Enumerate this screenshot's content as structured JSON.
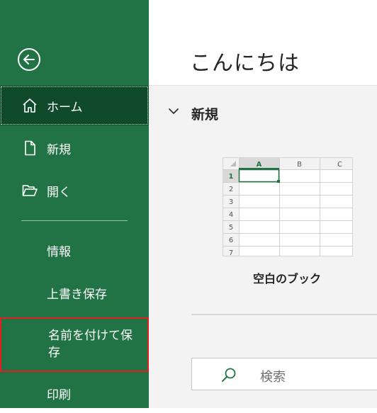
{
  "sidebar": {
    "back_icon": "arrow-left-circle-icon",
    "items": [
      {
        "label": "ホーム",
        "icon": "home-icon",
        "selected": true
      },
      {
        "label": "新規",
        "icon": "new-document-icon"
      },
      {
        "label": "開く",
        "icon": "open-folder-icon"
      },
      {
        "label": "情報"
      },
      {
        "label": "上書き保存"
      },
      {
        "label": "名前を付けて保存",
        "highlighted": true
      },
      {
        "label": "印刷"
      }
    ]
  },
  "main": {
    "title": "こんにちは",
    "new_section": {
      "title": "新規",
      "template": {
        "label": "空白のブック",
        "columns": [
          "A",
          "B",
          "C"
        ],
        "rows": [
          "1",
          "2",
          "3",
          "4",
          "5",
          "6",
          "7"
        ]
      }
    },
    "search": {
      "placeholder": "検索",
      "icon": "search-icon"
    }
  },
  "colors": {
    "sidebar_bg": "#217346",
    "selected_bg": "#0f4a2a",
    "highlight_border": "#e02020",
    "content_bg": "#f3f3f3"
  }
}
